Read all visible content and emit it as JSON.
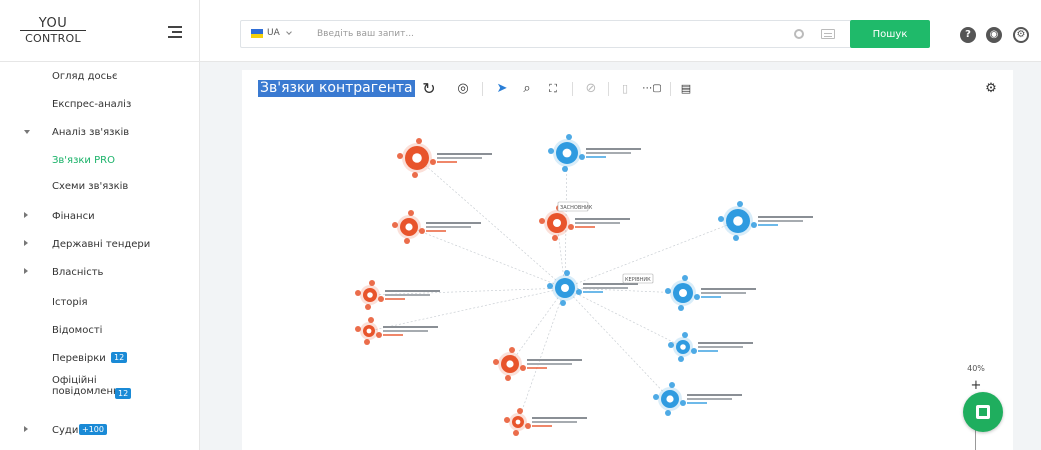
{
  "logo": {
    "line1": "YOU",
    "line2": "CONTROL"
  },
  "sidebar": {
    "items": [
      {
        "label": "Огляд досьє",
        "caret": "",
        "badge": ""
      },
      {
        "label": "Експрес-аналіз",
        "caret": "",
        "badge": ""
      },
      {
        "label": "Аналіз зв'язків",
        "caret": "down",
        "badge": ""
      },
      {
        "label": "Зв'язки PRO",
        "caret": "",
        "badge": "",
        "active": true
      },
      {
        "label": "Схеми зв'язків",
        "caret": "",
        "badge": ""
      },
      {
        "label": "Фінанси",
        "caret": "right",
        "badge": ""
      },
      {
        "label": "Державні тендери",
        "caret": "right",
        "badge": ""
      },
      {
        "label": "Власність",
        "caret": "right",
        "badge": ""
      },
      {
        "label": "Історія",
        "caret": "",
        "badge": ""
      },
      {
        "label": "Відомості",
        "caret": "",
        "badge": ""
      },
      {
        "label": "Перевірки",
        "caret": "",
        "badge": "12"
      },
      {
        "label": "Офіційні повідомлення",
        "caret": "",
        "badge": "12"
      },
      {
        "label": "Суди",
        "caret": "right",
        "badge": "+100"
      }
    ]
  },
  "search": {
    "country": "UA",
    "placeholder": "Введіть ваш запит...",
    "button": "Пошук"
  },
  "panel": {
    "title": "Зв'язки контрагента",
    "zoom": "40%",
    "zoom_plus": "+"
  },
  "colors": {
    "accent_green": "#1fba6a",
    "node_blue": "#2f9be0",
    "node_orange": "#e8542b",
    "title_bg": "#3a7ad1"
  },
  "graph": {
    "edge_labels": [
      "ЗАСНОВНИК",
      "КЕРІВНИК"
    ]
  }
}
